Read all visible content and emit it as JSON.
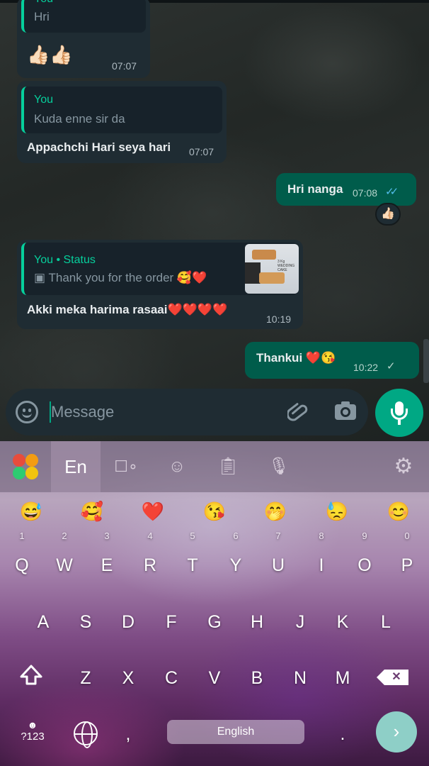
{
  "chat": {
    "messages": [
      {
        "quote_name": "You",
        "quote_text": "Hri",
        "text": "👍🏻👍🏻",
        "time": "07:07"
      },
      {
        "quote_name": "You",
        "quote_text": "Kuda enne sir  da",
        "text": "Appachchi Hari seya hari",
        "time": "07:07"
      },
      {
        "text": "Hri nanga",
        "time": "07:08",
        "ticks": "✓✓",
        "reaction": "👍🏻"
      },
      {
        "quote_name": "You • Status",
        "quote_text": "▣ Thank you for the order 🥰❤️",
        "text": "Akki meka harima rasaai❤️❤️❤️❤️",
        "time": "10:19"
      },
      {
        "text": "Thankui ❤️😘",
        "time": "10:22",
        "ticks": "✓"
      }
    ],
    "status_thumb_caption": "3 Kg WEDDING CAKE"
  },
  "input_bar": {
    "placeholder": "Message",
    "emoji_icon": "emoji-icon",
    "attach_icon": "paperclip-icon",
    "camera_icon": "camera-icon",
    "mic_icon": "mic-icon"
  },
  "keyboard": {
    "toolbar": {
      "language_tab": "En",
      "items": [
        "keyboard-logo",
        "language",
        "stickers",
        "emoji",
        "clipboard",
        "voice",
        "settings"
      ]
    },
    "emoji_suggestions": [
      "😅",
      "🥰",
      "❤️",
      "😘",
      "🤭",
      "😓",
      "😊"
    ],
    "rows": [
      {
        "keys": [
          "Q",
          "W",
          "E",
          "R",
          "T",
          "Y",
          "U",
          "I",
          "O",
          "P"
        ],
        "hints": [
          "1",
          "2",
          "3",
          "4",
          "5",
          "6",
          "7",
          "8",
          "9",
          "0"
        ]
      },
      {
        "keys": [
          "A",
          "S",
          "D",
          "F",
          "G",
          "H",
          "J",
          "K",
          "L"
        ]
      },
      {
        "keys": [
          "Z",
          "X",
          "C",
          "V",
          "B",
          "N",
          "M"
        ]
      }
    ],
    "sym_label": "?123",
    "comma": ",",
    "period": ".",
    "space_label": "English",
    "enter_glyph": "›",
    "backspace_glyph": "✕"
  }
}
